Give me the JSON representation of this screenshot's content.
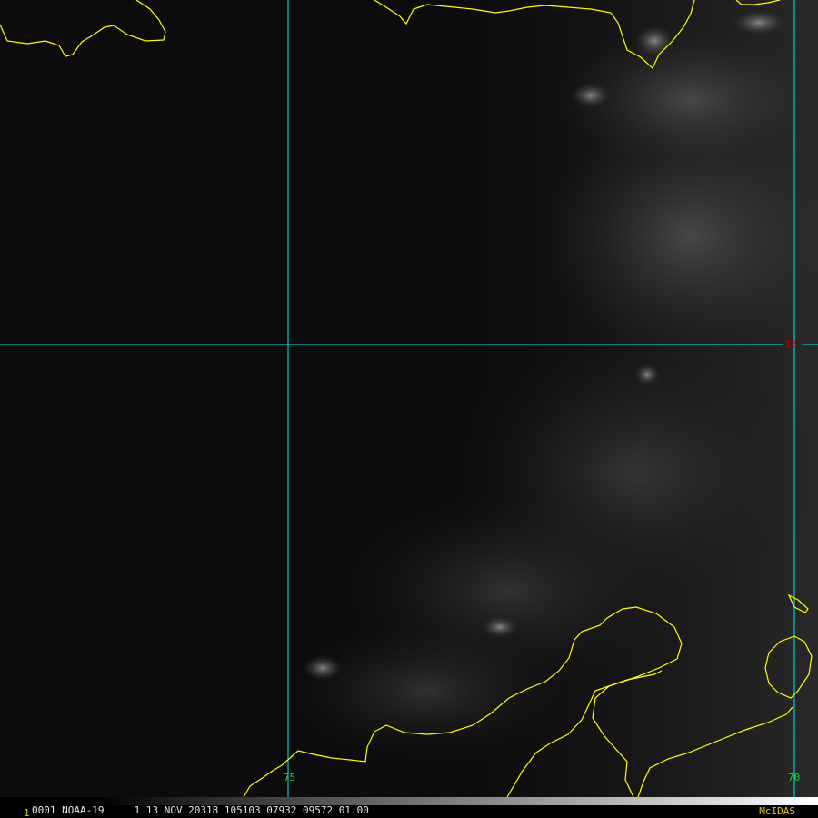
{
  "map": {
    "latitude_label": "15",
    "longitude_labels": [
      "75",
      "70"
    ]
  },
  "footer": {
    "frame_number": "1",
    "info_text": "0001 NOAA-19     1 13 NOV 20318 105103 07932 09572 01.00",
    "brand": "McIDAS"
  },
  "colors": {
    "coastline": "#ffff00",
    "gridline": "#00e5e5",
    "latitude_label": "#c40000",
    "longitude_label": "#2fd02f",
    "footer_brand": "#e0c020"
  }
}
